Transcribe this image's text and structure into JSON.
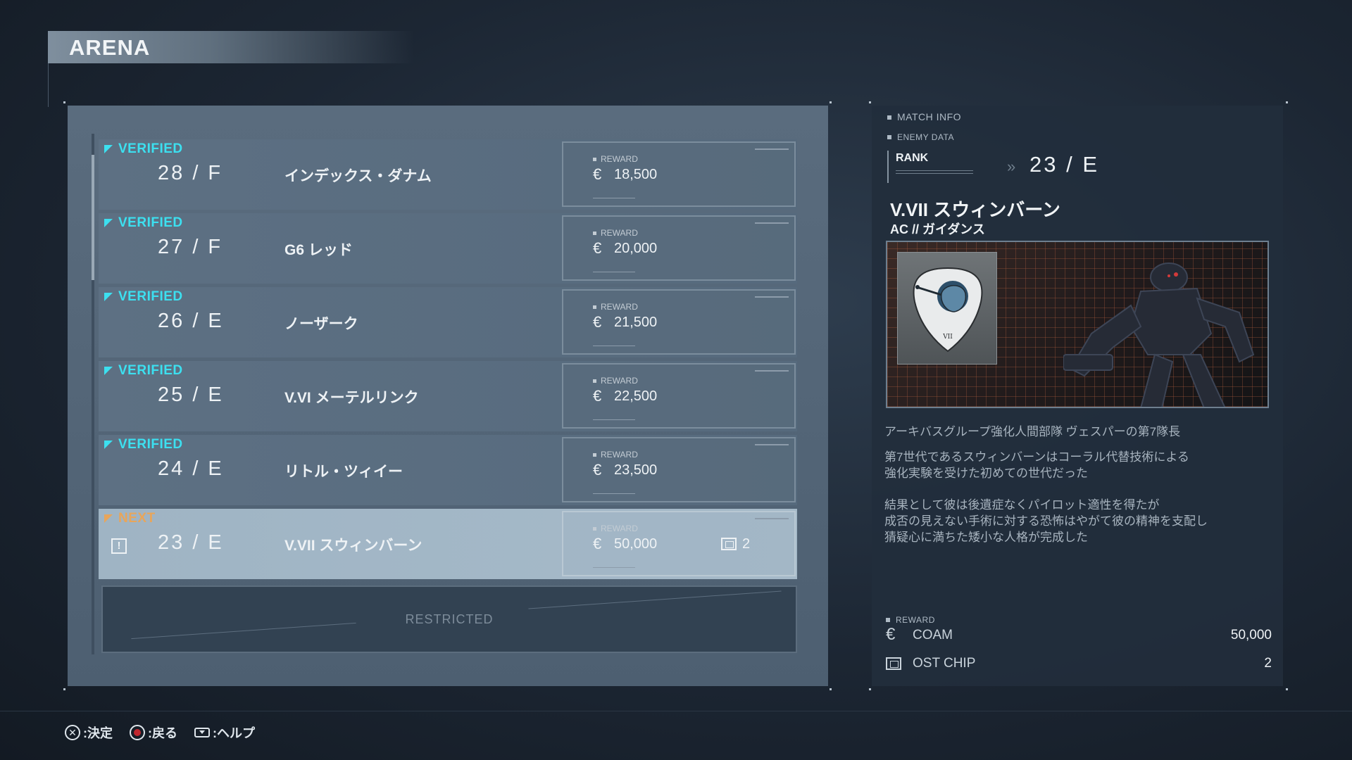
{
  "screen": {
    "title": "ARENA"
  },
  "arena_list": {
    "rows": [
      {
        "status": "VERIFIED",
        "rank": "28 / F",
        "name": "インデックス・ダナム",
        "reward_label": "REWARD",
        "currency": "€",
        "reward": "18,500"
      },
      {
        "status": "VERIFIED",
        "rank": "27 / F",
        "name": "G6 レッド",
        "reward_label": "REWARD",
        "currency": "€",
        "reward": "20,000"
      },
      {
        "status": "VERIFIED",
        "rank": "26 / E",
        "name": "ノーザーク",
        "reward_label": "REWARD",
        "currency": "€",
        "reward": "21,500"
      },
      {
        "status": "VERIFIED",
        "rank": "25 / E",
        "name": "V.VI メーテルリンク",
        "reward_label": "REWARD",
        "currency": "€",
        "reward": "22,500"
      },
      {
        "status": "VERIFIED",
        "rank": "24 / E",
        "name": "リトル・ツィイー",
        "reward_label": "REWARD",
        "currency": "€",
        "reward": "23,500"
      }
    ],
    "next_row": {
      "status": "NEXT",
      "alert": "!",
      "rank": "23 / E",
      "name": "V.VII スウィンバーン",
      "reward_label": "REWARD",
      "currency": "€",
      "reward": "50,000",
      "chip_count": "2"
    },
    "restricted_label": "RESTRICTED"
  },
  "match_info": {
    "header": "MATCH INFO",
    "enemy_data_label": "ENEMY DATA",
    "rank_label": "RANK",
    "rank_arrow": "»",
    "rank_value": "23 / E",
    "enemy_name": "V.VII スウィンバーン",
    "enemy_sub": "AC //  ガイダンス",
    "emblem_text": "VII",
    "description": [
      "アーキバスグループ強化人間部隊 ヴェスパーの第7隊長",
      "第7世代であるスウィンバーンはコーラル代替技術による",
      "強化実験を受けた初めての世代だった",
      "結果として彼は後遺症なくパイロット適性を得たが",
      "成否の見えない手術に対する恐怖はやがて彼の精神を支配し",
      "猜疑心に満ちた矮小な人格が完成した"
    ],
    "reward_label": "REWARD",
    "rewards": [
      {
        "icon": "€",
        "label": "COAM",
        "value": "50,000"
      },
      {
        "icon": "chip-icon",
        "label": "OST CHIP",
        "value": "2"
      }
    ]
  },
  "footer": {
    "confirm": ":決定",
    "back": ":戻る",
    "help": ":ヘルプ",
    "x_symbol": "✕"
  }
}
